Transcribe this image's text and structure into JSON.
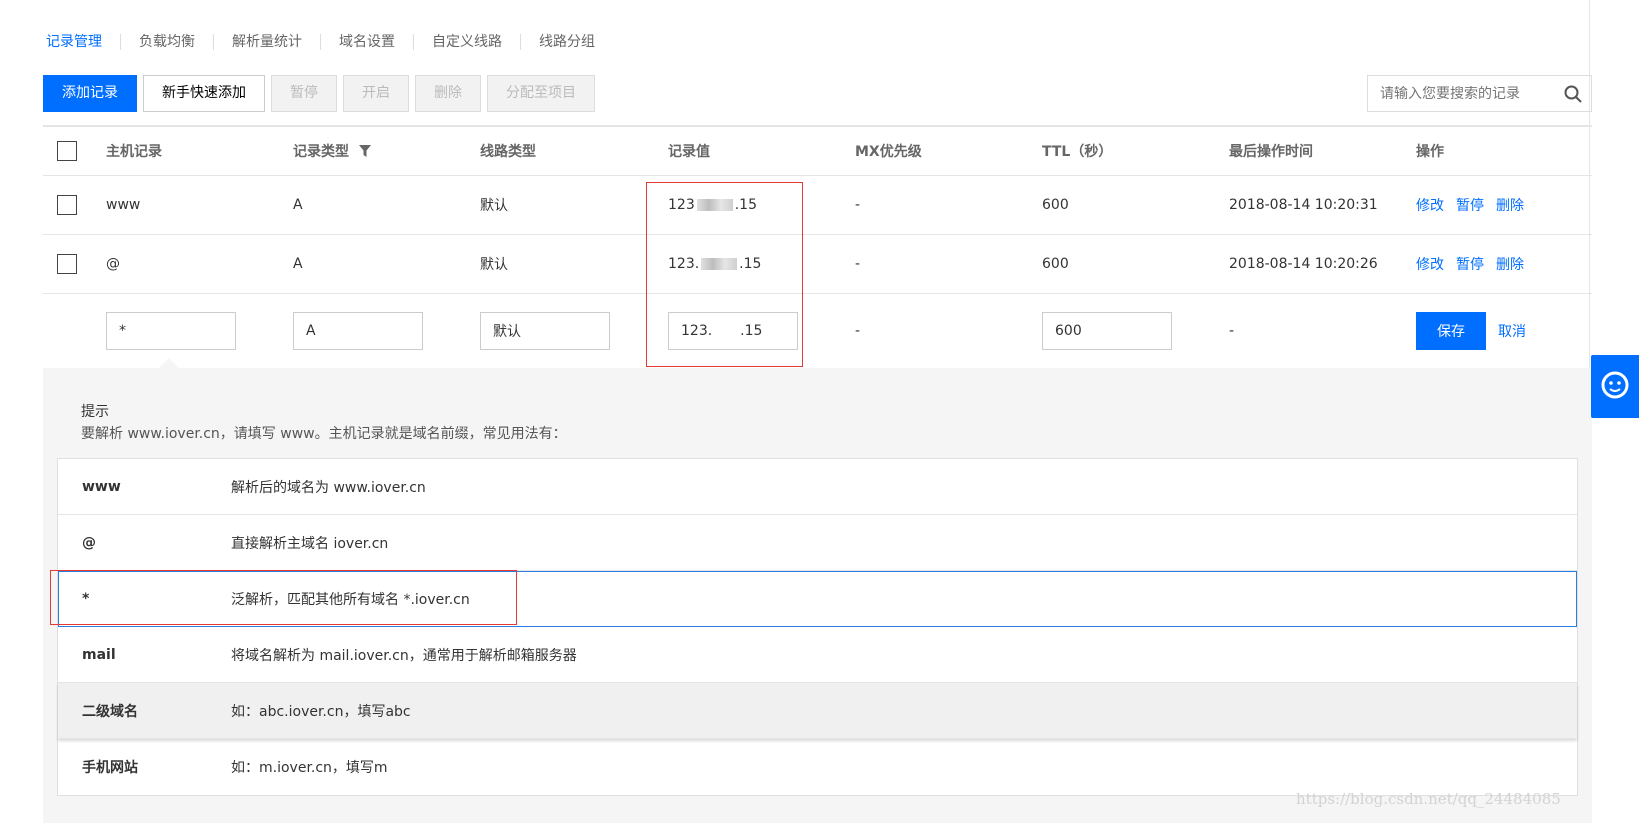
{
  "tabs": [
    "记录管理",
    "负载均衡",
    "解析量统计",
    "域名设置",
    "自定义线路",
    "线路分组"
  ],
  "toolbar": {
    "add": "添加记录",
    "quick_add": "新手快速添加",
    "pause": "暂停",
    "enable": "开启",
    "delete": "删除",
    "assign": "分配至项目"
  },
  "search": {
    "placeholder": "请输入您要搜索的记录",
    "icon": "search-icon"
  },
  "table": {
    "headers": [
      "主机记录",
      "记录类型",
      "线路类型",
      "记录值",
      "MX优先级",
      "TTL（秒）",
      "最后操作时间",
      "操作"
    ],
    "rows": [
      {
        "host": "www",
        "type": "A",
        "line": "默认",
        "value_prefix": "123",
        "value_suffix": ".15",
        "mx": "-",
        "ttl": "600",
        "time": "2018-08-14 10:20:31",
        "ops": [
          "修改",
          "暂停",
          "删除"
        ]
      },
      {
        "host": "@",
        "type": "A",
        "line": "默认",
        "value_prefix": "123.",
        "value_suffix": ".15",
        "mx": "-",
        "ttl": "600",
        "time": "2018-08-14 10:20:26",
        "ops": [
          "修改",
          "暂停",
          "删除"
        ]
      }
    ],
    "edit_row": {
      "host": "*",
      "type": "A",
      "line": "默认",
      "value": "123.  .15",
      "mx": "-",
      "ttl": "600",
      "time": "-",
      "save": "保存",
      "cancel": "取消"
    }
  },
  "tips": {
    "title": "提示",
    "desc": "要解析 www.iover.cn，请填写 www。主机记录就是域名前缀，常见用法有：",
    "items": [
      {
        "key": "www",
        "val": "解析后的域名为 www.iover.cn"
      },
      {
        "key": "@",
        "val": "直接解析主域名 iover.cn"
      },
      {
        "key": "*",
        "val": "泛解析，匹配其他所有域名 *.iover.cn"
      },
      {
        "key": "mail",
        "val": "将域名解析为 mail.iover.cn，通常用于解析邮箱服务器"
      },
      {
        "key": "二级域名",
        "val": "如：abc.iover.cn，填写abc"
      },
      {
        "key": "手机网站",
        "val": "如：m.iover.cn，填写m"
      }
    ]
  },
  "watermark": "https://blog.csdn.net/qq_24484085",
  "colors": {
    "primary": "#006eff",
    "highlight_box": "#e53935"
  }
}
